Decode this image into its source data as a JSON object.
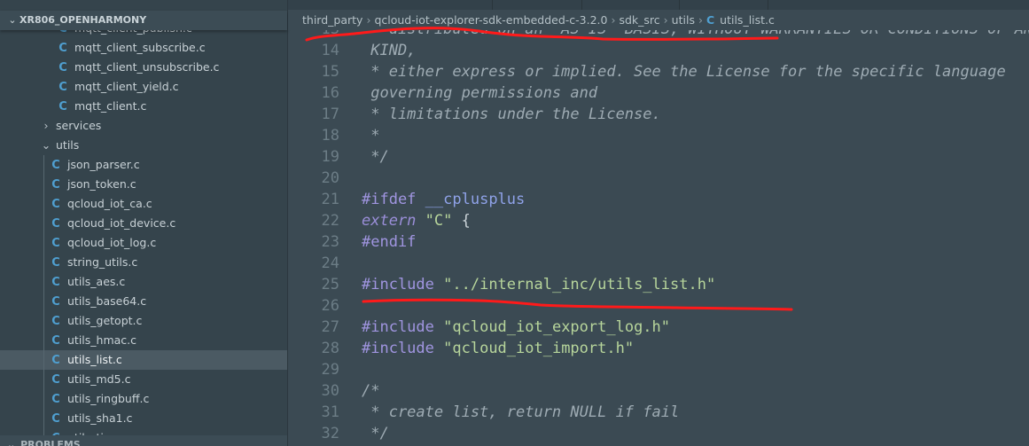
{
  "explorer": {
    "title": "XR806_OPENHARMONY",
    "items": [
      {
        "label": "mqtt_client_publish.c",
        "type": "file",
        "depth": 2
      },
      {
        "label": "mqtt_client_subscribe.c",
        "type": "file",
        "depth": 2
      },
      {
        "label": "mqtt_client_unsubscribe.c",
        "type": "file",
        "depth": 2
      },
      {
        "label": "mqtt_client_yield.c",
        "type": "file",
        "depth": 2
      },
      {
        "label": "mqtt_client.c",
        "type": "file",
        "depth": 2
      },
      {
        "label": "services",
        "type": "folder-collapsed",
        "depth": 1
      },
      {
        "label": "utils",
        "type": "folder-expanded",
        "depth": 1
      },
      {
        "label": "json_parser.c",
        "type": "file",
        "depth": 2
      },
      {
        "label": "json_token.c",
        "type": "file",
        "depth": 2
      },
      {
        "label": "qcloud_iot_ca.c",
        "type": "file",
        "depth": 2
      },
      {
        "label": "qcloud_iot_device.c",
        "type": "file",
        "depth": 2
      },
      {
        "label": "qcloud_iot_log.c",
        "type": "file",
        "depth": 2
      },
      {
        "label": "string_utils.c",
        "type": "file",
        "depth": 2
      },
      {
        "label": "utils_aes.c",
        "type": "file",
        "depth": 2
      },
      {
        "label": "utils_base64.c",
        "type": "file",
        "depth": 2
      },
      {
        "label": "utils_getopt.c",
        "type": "file",
        "depth": 2
      },
      {
        "label": "utils_hmac.c",
        "type": "file",
        "depth": 2
      },
      {
        "label": "utils_list.c",
        "type": "file",
        "depth": 2,
        "selected": true
      },
      {
        "label": "utils_md5.c",
        "type": "file",
        "depth": 2
      },
      {
        "label": "utils_ringbuff.c",
        "type": "file",
        "depth": 2
      },
      {
        "label": "utils_sha1.c",
        "type": "file",
        "depth": 2
      },
      {
        "label": "utils_time.c",
        "type": "file",
        "depth": 2
      }
    ],
    "file_icon_glyph": "C",
    "file_icon_color": "#4f9fd0"
  },
  "problems_panel": {
    "title": "PROBLEMS"
  },
  "breadcrumb": {
    "segments": [
      "third_party",
      "qcloud-iot-explorer-sdk-embedded-c-3.2.0",
      "sdk_src",
      "utils"
    ],
    "file": "utils_list.c",
    "separator": "›"
  },
  "editor": {
    "lines": [
      {
        "n": "13",
        "tokens": [
          {
            "t": " * distributed on an \"AS IS\" BASIS, WITHOUT WARRANTIES OR CONDITIONS OF ANY",
            "c": "cm"
          }
        ]
      },
      {
        "n": "14",
        "tokens": [
          {
            "t": " KIND,",
            "c": "cm"
          }
        ]
      },
      {
        "n": "15",
        "tokens": [
          {
            "t": " * either express or implied. See the License for the specific language",
            "c": "cm"
          }
        ]
      },
      {
        "n": "16",
        "tokens": [
          {
            "t": " governing permissions and",
            "c": "cm"
          }
        ]
      },
      {
        "n": "17",
        "tokens": [
          {
            "t": " * limitations under the License.",
            "c": "cm"
          }
        ]
      },
      {
        "n": "18",
        "tokens": [
          {
            "t": " *",
            "c": "cm"
          }
        ]
      },
      {
        "n": "19",
        "tokens": [
          {
            "t": " */",
            "c": "cm"
          }
        ]
      },
      {
        "n": "20",
        "tokens": []
      },
      {
        "n": "21",
        "tokens": [
          {
            "t": "#ifdef",
            "c": "kw"
          },
          {
            "t": " ",
            "c": "pl"
          },
          {
            "t": "__cplusplus",
            "c": "mac"
          }
        ]
      },
      {
        "n": "22",
        "tokens": [
          {
            "t": "extern",
            "c": "kwi"
          },
          {
            "t": " ",
            "c": "pl"
          },
          {
            "t": "\"C\"",
            "c": "str"
          },
          {
            "t": " {",
            "c": "pl"
          }
        ]
      },
      {
        "n": "23",
        "tokens": [
          {
            "t": "#endif",
            "c": "kw"
          }
        ]
      },
      {
        "n": "24",
        "tokens": []
      },
      {
        "n": "25",
        "tokens": [
          {
            "t": "#include",
            "c": "kw"
          },
          {
            "t": " ",
            "c": "pl"
          },
          {
            "t": "\"../internal_inc/utils_list.h\"",
            "c": "str"
          }
        ]
      },
      {
        "n": "26",
        "tokens": []
      },
      {
        "n": "27",
        "tokens": [
          {
            "t": "#include",
            "c": "kw"
          },
          {
            "t": " ",
            "c": "pl"
          },
          {
            "t": "\"qcloud_iot_export_log.h\"",
            "c": "str"
          }
        ]
      },
      {
        "n": "28",
        "tokens": [
          {
            "t": "#include",
            "c": "kw"
          },
          {
            "t": " ",
            "c": "pl"
          },
          {
            "t": "\"qcloud_iot_import.h\"",
            "c": "str"
          }
        ]
      },
      {
        "n": "29",
        "tokens": []
      },
      {
        "n": "30",
        "tokens": [
          {
            "t": "/*",
            "c": "cm"
          }
        ]
      },
      {
        "n": "31",
        "tokens": [
          {
            "t": " * create list, return NULL if fail",
            "c": "cm"
          }
        ]
      },
      {
        "n": "32",
        "tokens": [
          {
            "t": " */",
            "c": "cm"
          }
        ]
      }
    ]
  },
  "annotations": {
    "color": "#ff1a1a"
  }
}
